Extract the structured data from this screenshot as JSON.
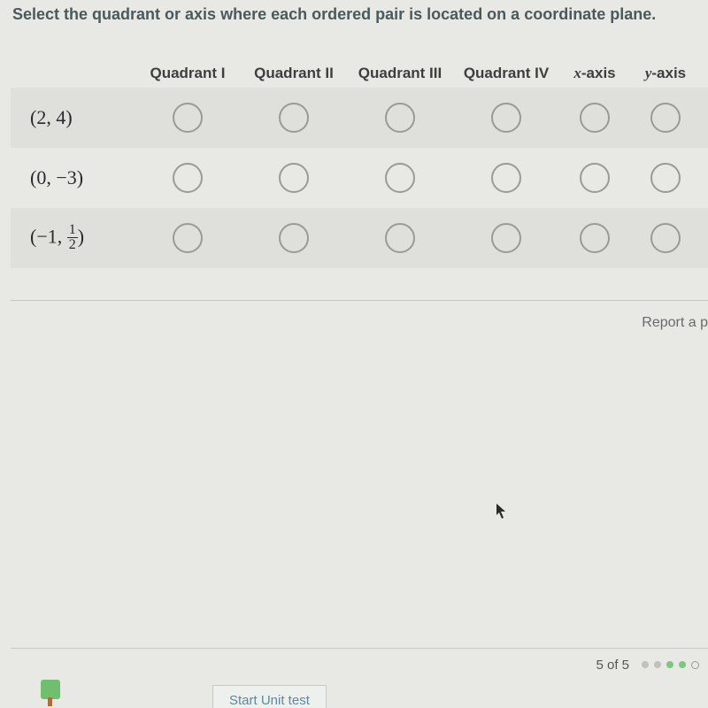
{
  "prompt": "Select the quadrant or axis where each ordered pair is located on a coordinate plane.",
  "columns": {
    "c0": "Quadrant I",
    "c1": "Quadrant II",
    "c2": "Quadrant III",
    "c3": "Quadrant IV",
    "c4_var": "x",
    "c4_sfx": "-axis",
    "c5_var": "y",
    "c5_sfx": "-axis"
  },
  "rows": {
    "r0_label": "(2, 4)",
    "r1_label": "(0, −3)",
    "r2_pre": "(−1, ",
    "r2_num": "1",
    "r2_den": "2",
    "r2_post": ")"
  },
  "report": "Report a p",
  "footer": {
    "progress": "5 of 5",
    "start": "Start Unit test"
  }
}
